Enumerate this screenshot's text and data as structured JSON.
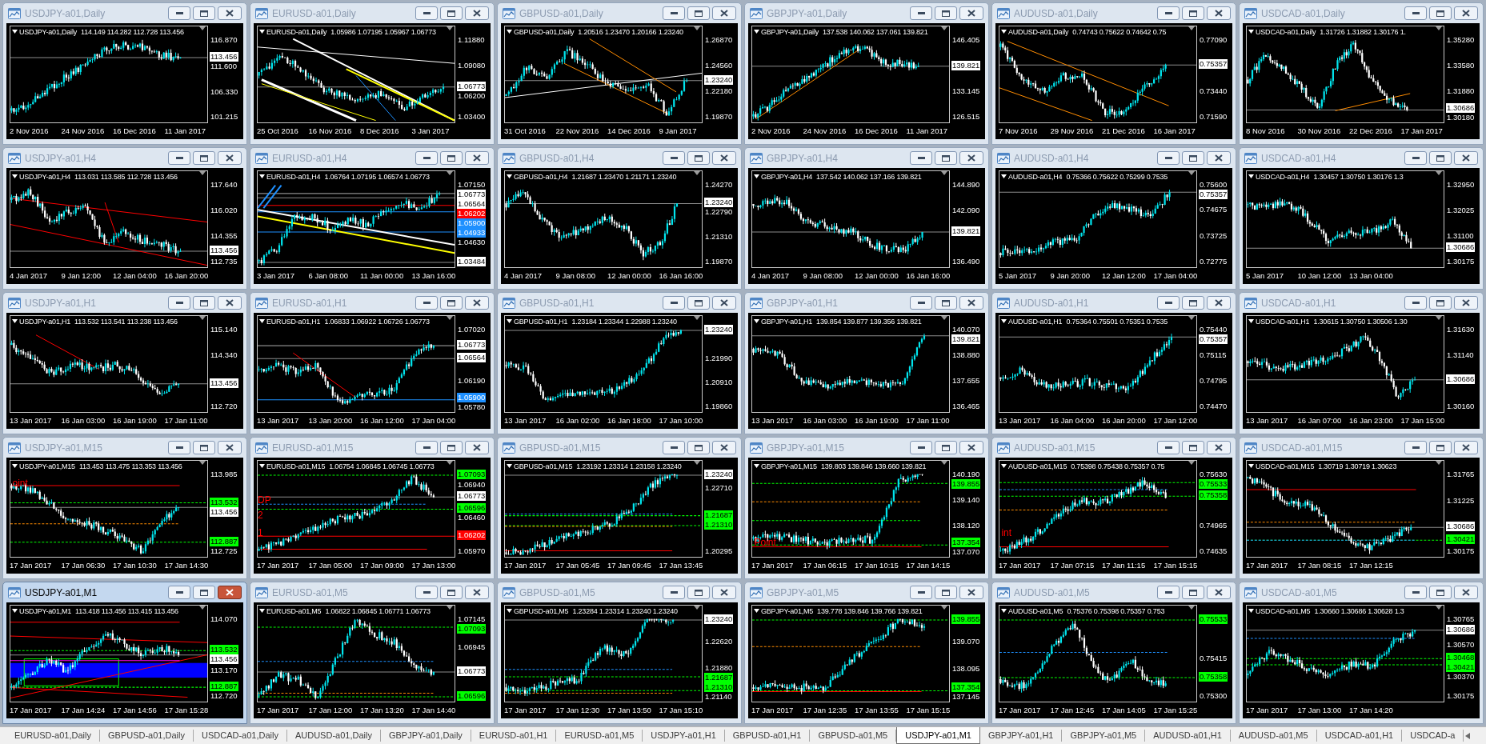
{
  "windows": [
    {
      "title": "USDJPY-a01,Daily",
      "active": false,
      "chart": {
        "symbol": "USDJPY-a01,Daily",
        "ohlc": "114.149 114.282 112.728 113.456",
        "price_labels": [
          {
            "text": "116.870",
            "kind": "tick"
          },
          {
            "text": "113.456",
            "kind": "marker",
            "color": "#ffffff"
          },
          {
            "text": "111.600",
            "kind": "tick"
          },
          {
            "text": "106.330",
            "kind": "tick"
          },
          {
            "text": "101.215",
            "kind": "tick"
          }
        ],
        "time_labels": [
          "2 Nov 2016",
          "24 Nov 2016",
          "16 Dec 2016",
          "11 Jan 2017"
        ]
      }
    },
    {
      "title": "EURUSD-a01,Daily",
      "active": false,
      "chart": {
        "symbol": "EURUSD-a01,Daily",
        "ohlc": "1.05986 1.07195 1.05967 1.06773",
        "price_labels": [
          {
            "text": "1.11880",
            "kind": "tick"
          },
          {
            "text": "1.09080",
            "kind": "tick"
          },
          {
            "text": "1.06773",
            "kind": "marker",
            "color": "#ffffff"
          },
          {
            "text": "1.06200",
            "kind": "tick"
          },
          {
            "text": "1.03400",
            "kind": "tick"
          }
        ],
        "time_labels": [
          "25 Oct 2016",
          "16 Nov 2016",
          "8 Dec 2016",
          "3 Jan 2017"
        ]
      }
    },
    {
      "title": "GBPUSD-a01,Daily",
      "active": false,
      "chart": {
        "symbol": "GBPUSD-a01,Daily",
        "ohlc": "1.20516 1.23470 1.20166 1.23240",
        "price_labels": [
          {
            "text": "1.26870",
            "kind": "tick"
          },
          {
            "text": "1.24560",
            "kind": "tick"
          },
          {
            "text": "1.23240",
            "kind": "marker",
            "color": "#ffffff"
          },
          {
            "text": "1.22180",
            "kind": "tick"
          },
          {
            "text": "1.19870",
            "kind": "tick"
          }
        ],
        "time_labels": [
          "31 Oct 2016",
          "22 Nov 2016",
          "14 Dec 2016",
          "9 Jan 2017"
        ]
      }
    },
    {
      "title": "GBPJPY-a01,Daily",
      "active": false,
      "chart": {
        "symbol": "GBPJPY-a01,Daily",
        "ohlc": "137.538 140.062 137.061 139.821",
        "price_labels": [
          {
            "text": "146.405",
            "kind": "tick"
          },
          {
            "text": "139.821",
            "kind": "marker",
            "color": "#ffffff"
          },
          {
            "text": "133.145",
            "kind": "tick"
          },
          {
            "text": "126.515",
            "kind": "tick"
          }
        ],
        "time_labels": [
          "2 Nov 2016",
          "24 Nov 2016",
          "16 Dec 2016",
          "11 Jan 2017"
        ]
      }
    },
    {
      "title": "AUDUSD-a01,Daily",
      "active": false,
      "chart": {
        "symbol": "AUDUSD-a01,Daily",
        "ohlc": "0.74743 0.75622 0.74642 0.75",
        "price_labels": [
          {
            "text": "0.77090",
            "kind": "tick"
          },
          {
            "text": "0.75357",
            "kind": "marker",
            "color": "#ffffff"
          },
          {
            "text": "0.73440",
            "kind": "tick"
          },
          {
            "text": "0.71590",
            "kind": "tick"
          }
        ],
        "time_labels": [
          "7 Nov 2016",
          "29 Nov 2016",
          "21 Dec 2016",
          "16 Jan 2017"
        ]
      }
    },
    {
      "title": "USDCAD-a01,Daily",
      "active": false,
      "chart": {
        "symbol": "USDCAD-a01,Daily",
        "ohlc": "1.31726 1.31882 1.30176 1.",
        "price_labels": [
          {
            "text": "1.35280",
            "kind": "tick"
          },
          {
            "text": "1.33580",
            "kind": "tick"
          },
          {
            "text": "1.31880",
            "kind": "tick"
          },
          {
            "text": "1.30686",
            "kind": "marker",
            "color": "#ffffff"
          },
          {
            "text": "1.30180",
            "kind": "tick"
          }
        ],
        "time_labels": [
          "8 Nov 2016",
          "30 Nov 2016",
          "22 Dec 2016",
          "17 Jan 2017"
        ]
      }
    },
    {
      "title": "USDJPY-a01,H4",
      "active": false,
      "chart": {
        "symbol": "USDJPY-a01,H4",
        "ohlc": "113.031 113.585 112.728 113.456",
        "price_labels": [
          {
            "text": "117.640",
            "kind": "tick"
          },
          {
            "text": "116.020",
            "kind": "tick"
          },
          {
            "text": "114.355",
            "kind": "tick"
          },
          {
            "text": "113.456",
            "kind": "marker",
            "color": "#ffffff"
          },
          {
            "text": "112.735",
            "kind": "tick"
          }
        ],
        "time_labels": [
          "4 Jan 2017",
          "9 Jan 12:00",
          "12 Jan 04:00",
          "16 Jan 20:00"
        ]
      }
    },
    {
      "title": "EURUSD-a01,H4",
      "active": false,
      "chart": {
        "symbol": "EURUSD-a01,H4",
        "ohlc": "1.06764 1.07195 1.06574 1.06773",
        "price_labels": [
          {
            "text": "1.07150",
            "kind": "tick"
          },
          {
            "text": "1.06773",
            "kind": "marker",
            "color": "#ffffff"
          },
          {
            "text": "1.06564",
            "kind": "marker",
            "color": "#ffffff"
          },
          {
            "text": "1.06202",
            "kind": "marker",
            "color": "#ff0000"
          },
          {
            "text": "1.05900",
            "kind": "marker",
            "color": "#1e90ff"
          },
          {
            "text": "1.04933",
            "kind": "marker",
            "color": "#1e90ff"
          },
          {
            "text": "1.04630",
            "kind": "tick"
          },
          {
            "text": "1.03484",
            "kind": "marker",
            "color": "#ffffff"
          }
        ],
        "time_labels": [
          "3 Jan 2017",
          "6 Jan 08:00",
          "11 Jan 00:00",
          "13 Jan 16:00"
        ]
      }
    },
    {
      "title": "GBPUSD-a01,H4",
      "active": false,
      "chart": {
        "symbol": "GBPUSD-a01,H4",
        "ohlc": "1.21687 1.23470 1.21171 1.23240",
        "price_labels": [
          {
            "text": "1.24270",
            "kind": "tick"
          },
          {
            "text": "1.23240",
            "kind": "marker",
            "color": "#ffffff"
          },
          {
            "text": "1.22790",
            "kind": "tick"
          },
          {
            "text": "1.21310",
            "kind": "tick"
          },
          {
            "text": "1.19870",
            "kind": "tick"
          }
        ],
        "time_labels": [
          "4 Jan 2017",
          "9 Jan 08:00",
          "12 Jan 00:00",
          "16 Jan 16:00"
        ]
      }
    },
    {
      "title": "GBPJPY-a01,H4",
      "active": false,
      "chart": {
        "symbol": "GBPJPY-a01,H4",
        "ohlc": "137.542 140.062 137.166 139.821",
        "price_labels": [
          {
            "text": "144.890",
            "kind": "tick"
          },
          {
            "text": "142.090",
            "kind": "tick"
          },
          {
            "text": "139.821",
            "kind": "marker",
            "color": "#ffffff"
          },
          {
            "text": "136.490",
            "kind": "tick"
          }
        ],
        "time_labels": [
          "4 Jan 2017",
          "9 Jan 08:00",
          "12 Jan 00:00",
          "16 Jan 16:00"
        ]
      }
    },
    {
      "title": "AUDUSD-a01,H4",
      "active": false,
      "chart": {
        "symbol": "AUDUSD-a01,H4",
        "ohlc": "0.75366 0.75622 0.75299 0.7535",
        "price_labels": [
          {
            "text": "0.75600",
            "kind": "tick"
          },
          {
            "text": "0.75357",
            "kind": "marker",
            "color": "#ffffff"
          },
          {
            "text": "0.74675",
            "kind": "tick"
          },
          {
            "text": "0.73725",
            "kind": "tick"
          },
          {
            "text": "0.72775",
            "kind": "tick"
          }
        ],
        "time_labels": [
          "5 Jan 2017",
          "9 Jan 20:00",
          "12 Jan 12:00",
          "17 Jan 04:00"
        ]
      }
    },
    {
      "title": "USDCAD-a01,H4",
      "active": false,
      "chart": {
        "symbol": "USDCAD-a01,H4",
        "ohlc": "1.30457 1.30750 1.30176 1.3",
        "price_labels": [
          {
            "text": "1.32950",
            "kind": "tick"
          },
          {
            "text": "1.32025",
            "kind": "tick"
          },
          {
            "text": "1.31100",
            "kind": "tick"
          },
          {
            "text": "1.30686",
            "kind": "marker",
            "color": "#ffffff"
          },
          {
            "text": "1.30175",
            "kind": "tick"
          }
        ],
        "time_labels": [
          "5 Jan 2017",
          "10 Jan 12:00",
          "13 Jan 04:00"
        ]
      }
    },
    {
      "title": "USDJPY-a01,H1",
      "active": false,
      "chart": {
        "symbol": "USDJPY-a01,H1",
        "ohlc": "113.532 113.541 113.238 113.456",
        "price_labels": [
          {
            "text": "115.140",
            "kind": "tick"
          },
          {
            "text": "114.340",
            "kind": "tick"
          },
          {
            "text": "113.456",
            "kind": "marker",
            "color": "#ffffff"
          },
          {
            "text": "112.720",
            "kind": "tick"
          }
        ],
        "time_labels": [
          "13 Jan 2017",
          "16 Jan 03:00",
          "16 Jan 19:00",
          "17 Jan 11:00"
        ]
      }
    },
    {
      "title": "EURUSD-a01,H1",
      "active": false,
      "chart": {
        "symbol": "EURUSD-a01,H1",
        "ohlc": "1.06833 1.06922 1.06726 1.06773",
        "price_labels": [
          {
            "text": "1.07020",
            "kind": "tick"
          },
          {
            "text": "1.06773",
            "kind": "marker",
            "color": "#ffffff"
          },
          {
            "text": "1.06564",
            "kind": "marker",
            "color": "#ffffff"
          },
          {
            "text": "1.06190",
            "kind": "tick"
          },
          {
            "text": "1.05900",
            "kind": "marker",
            "color": "#1e90ff"
          },
          {
            "text": "1.05780",
            "kind": "tick"
          }
        ],
        "time_labels": [
          "13 Jan 2017",
          "13 Jan 20:00",
          "16 Jan 12:00",
          "17 Jan 04:00"
        ]
      }
    },
    {
      "title": "GBPUSD-a01,H1",
      "active": false,
      "chart": {
        "symbol": "GBPUSD-a01,H1",
        "ohlc": "1.23184 1.23344 1.22988 1.23240",
        "price_labels": [
          {
            "text": "1.23240",
            "kind": "marker",
            "color": "#ffffff"
          },
          {
            "text": "1.21990",
            "kind": "tick"
          },
          {
            "text": "1.20910",
            "kind": "tick"
          },
          {
            "text": "1.19860",
            "kind": "tick"
          }
        ],
        "time_labels": [
          "13 Jan 2017",
          "16 Jan 02:00",
          "16 Jan 18:00",
          "17 Jan 10:00"
        ]
      }
    },
    {
      "title": "GBPJPY-a01,H1",
      "active": false,
      "chart": {
        "symbol": "GBPJPY-a01,H1",
        "ohlc": "139.854 139.877 139.356 139.821",
        "price_labels": [
          {
            "text": "140.070",
            "kind": "tick"
          },
          {
            "text": "139.821",
            "kind": "marker",
            "color": "#ffffff"
          },
          {
            "text": "138.880",
            "kind": "tick"
          },
          {
            "text": "137.655",
            "kind": "tick"
          },
          {
            "text": "136.465",
            "kind": "tick"
          }
        ],
        "time_labels": [
          "13 Jan 2017",
          "16 Jan 03:00",
          "16 Jan 19:00",
          "17 Jan 11:00"
        ]
      }
    },
    {
      "title": "AUDUSD-a01,H1",
      "active": false,
      "chart": {
        "symbol": "AUDUSD-a01,H1",
        "ohlc": "0.75364 0.75501 0.75351 0.7535",
        "price_labels": [
          {
            "text": "0.75440",
            "kind": "tick"
          },
          {
            "text": "0.75357",
            "kind": "marker",
            "color": "#ffffff"
          },
          {
            "text": "0.75115",
            "kind": "tick"
          },
          {
            "text": "0.74795",
            "kind": "tick"
          },
          {
            "text": "0.74470",
            "kind": "tick"
          }
        ],
        "time_labels": [
          "13 Jan 2017",
          "16 Jan 04:00",
          "16 Jan 20:00",
          "17 Jan 12:00"
        ]
      }
    },
    {
      "title": "USDCAD-a01,H1",
      "active": false,
      "chart": {
        "symbol": "USDCAD-a01,H1",
        "ohlc": "1.30615 1.30750 1.30506 1.30",
        "price_labels": [
          {
            "text": "1.31630",
            "kind": "tick"
          },
          {
            "text": "1.31140",
            "kind": "tick"
          },
          {
            "text": "1.30686",
            "kind": "marker",
            "color": "#ffffff"
          },
          {
            "text": "1.30160",
            "kind": "tick"
          }
        ],
        "time_labels": [
          "13 Jan 2017",
          "16 Jan 07:00",
          "16 Jan 23:00",
          "17 Jan 15:00"
        ]
      }
    },
    {
      "title": "USDJPY-a01,M15",
      "active": false,
      "chart": {
        "symbol": "USDJPY-a01,M15",
        "ohlc": "113.453 113.475 113.353 113.456",
        "price_labels": [
          {
            "text": "113.985",
            "kind": "tick"
          },
          {
            "text": "113.532",
            "kind": "marker",
            "color": "#00ff00"
          },
          {
            "text": "113.456",
            "kind": "marker",
            "color": "#ffffff"
          },
          {
            "text": "112.887",
            "kind": "marker",
            "color": "#00ff00"
          },
          {
            "text": "112.725",
            "kind": "tick"
          }
        ],
        "time_labels": [
          "17 Jan 2017",
          "17 Jan 06:30",
          "17 Jan 10:30",
          "17 Jan 14:30"
        ],
        "annotations": [
          "oint"
        ]
      }
    },
    {
      "title": "EURUSD-a01,M15",
      "active": false,
      "chart": {
        "symbol": "EURUSD-a01,M15",
        "ohlc": "1.06754 1.06845 1.06745 1.06773",
        "price_labels": [
          {
            "text": "1.07093",
            "kind": "marker",
            "color": "#00ff00"
          },
          {
            "text": "1.06940",
            "kind": "tick"
          },
          {
            "text": "1.06773",
            "kind": "marker",
            "color": "#ffffff"
          },
          {
            "text": "1.06596",
            "kind": "marker",
            "color": "#00ff00"
          },
          {
            "text": "1.06460",
            "kind": "tick"
          },
          {
            "text": "1.06202",
            "kind": "marker",
            "color": "#ff0000"
          },
          {
            "text": "1.05970",
            "kind": "tick"
          }
        ],
        "time_labels": [
          "17 Jan 2017",
          "17 Jan 05:00",
          "17 Jan 09:00",
          "17 Jan 13:00"
        ],
        "annotations": [
          "DP",
          "2",
          "1"
        ]
      }
    },
    {
      "title": "GBPUSD-a01,M15",
      "active": false,
      "chart": {
        "symbol": "GBPUSD-a01,M15",
        "ohlc": "1.23192 1.23314 1.23158 1.23240",
        "price_labels": [
          {
            "text": "1.23240",
            "kind": "marker",
            "color": "#ffffff"
          },
          {
            "text": "1.22710",
            "kind": "tick"
          },
          {
            "text": "1.21687",
            "kind": "marker",
            "color": "#00ff00"
          },
          {
            "text": "1.21310",
            "kind": "marker",
            "color": "#00ff00"
          },
          {
            "text": "1.20295",
            "kind": "tick"
          }
        ],
        "time_labels": [
          "17 Jan 2017",
          "17 Jan 05:45",
          "17 Jan 09:45",
          "17 Jan 13:45"
        ]
      }
    },
    {
      "title": "GBPJPY-a01,M15",
      "active": false,
      "chart": {
        "symbol": "GBPJPY-a01,M15",
        "ohlc": "139.803 139.846 139.660 139.821",
        "price_labels": [
          {
            "text": "140.190",
            "kind": "tick"
          },
          {
            "text": "139.855",
            "kind": "marker",
            "color": "#00ff00"
          },
          {
            "text": "139.140",
            "kind": "tick"
          },
          {
            "text": "138.120",
            "kind": "tick"
          },
          {
            "text": "137.354",
            "kind": "marker",
            "color": "#00ff00"
          },
          {
            "text": "137.070",
            "kind": "tick"
          }
        ],
        "time_labels": [
          "17 Jan 2017",
          "17 Jan 06:15",
          "17 Jan 10:15",
          "17 Jan 14:15"
        ],
        "annotations": [
          "Point"
        ]
      }
    },
    {
      "title": "AUDUSD-a01,M15",
      "active": false,
      "chart": {
        "symbol": "AUDUSD-a01,M15",
        "ohlc": "0.75398 0.75438 0.75357 0.75",
        "price_labels": [
          {
            "text": "0.75630",
            "kind": "tick"
          },
          {
            "text": "0.75533",
            "kind": "marker",
            "color": "#00ff00"
          },
          {
            "text": "0.75358",
            "kind": "marker",
            "color": "#00ff00"
          },
          {
            "text": "0.74965",
            "kind": "tick"
          },
          {
            "text": "0.74635",
            "kind": "tick"
          }
        ],
        "time_labels": [
          "17 Jan 2017",
          "17 Jan 07:15",
          "17 Jan 11:15",
          "17 Jan 15:15"
        ],
        "annotations": [
          "int"
        ]
      }
    },
    {
      "title": "USDCAD-a01,M15",
      "active": false,
      "chart": {
        "symbol": "USDCAD-a01,M15",
        "ohlc": "1.30719 1.30719 1.30623",
        "price_labels": [
          {
            "text": "1.31765",
            "kind": "tick"
          },
          {
            "text": "1.31225",
            "kind": "tick"
          },
          {
            "text": "1.30686",
            "kind": "marker",
            "color": "#ffffff"
          },
          {
            "text": "1.30421",
            "kind": "marker",
            "color": "#00ff00"
          },
          {
            "text": "1.30175",
            "kind": "tick"
          }
        ],
        "time_labels": [
          "17 Jan 2017",
          "17 Jan 08:15",
          "17 Jan 12:15"
        ]
      }
    },
    {
      "title": "USDJPY-a01,M1",
      "active": true,
      "chart": {
        "symbol": "USDJPY-a01,M1",
        "ohlc": "113.418 113.456 113.415 113.456",
        "price_labels": [
          {
            "text": "114.070",
            "kind": "tick"
          },
          {
            "text": "113.532",
            "kind": "marker",
            "color": "#00ff00"
          },
          {
            "text": "113.456",
            "kind": "marker",
            "color": "#ffffff"
          },
          {
            "text": "113.170",
            "kind": "tick"
          },
          {
            "text": "112.887",
            "kind": "marker",
            "color": "#00ff00"
          },
          {
            "text": "112.720",
            "kind": "tick"
          }
        ],
        "time_labels": [
          "17 Jan 2017",
          "17 Jan 14:24",
          "17 Jan 14:56",
          "17 Jan 15:28"
        ]
      }
    },
    {
      "title": "EURUSD-a01,M5",
      "active": false,
      "chart": {
        "symbol": "EURUSD-a01,M5",
        "ohlc": "1.06822 1.06845 1.06771 1.06773",
        "price_labels": [
          {
            "text": "1.07145",
            "kind": "tick"
          },
          {
            "text": "1.07093",
            "kind": "marker",
            "color": "#00ff00"
          },
          {
            "text": "1.06945",
            "kind": "tick"
          },
          {
            "text": "1.06773",
            "kind": "marker",
            "color": "#ffffff"
          },
          {
            "text": "1.06596",
            "kind": "marker",
            "color": "#00ff00"
          }
        ],
        "time_labels": [
          "17 Jan 2017",
          "17 Jan 12:00",
          "17 Jan 13:20",
          "17 Jan 14:40"
        ]
      }
    },
    {
      "title": "GBPUSD-a01,M5",
      "active": false,
      "chart": {
        "symbol": "GBPUSD-a01,M5",
        "ohlc": "1.23284 1.23314 1.23240 1.23240",
        "price_labels": [
          {
            "text": "1.23240",
            "kind": "marker",
            "color": "#ffffff"
          },
          {
            "text": "1.22620",
            "kind": "tick"
          },
          {
            "text": "1.21880",
            "kind": "tick"
          },
          {
            "text": "1.21687",
            "kind": "marker",
            "color": "#00ff00"
          },
          {
            "text": "1.21310",
            "kind": "marker",
            "color": "#00ff00"
          },
          {
            "text": "1.21140",
            "kind": "tick"
          }
        ],
        "time_labels": [
          "17 Jan 2017",
          "17 Jan 12:30",
          "17 Jan 13:50",
          "17 Jan 15:10"
        ]
      }
    },
    {
      "title": "GBPJPY-a01,M5",
      "active": false,
      "chart": {
        "symbol": "GBPJPY-a01,M5",
        "ohlc": "139.778 139.846 139.766 139.821",
        "price_labels": [
          {
            "text": "139.855",
            "kind": "marker",
            "color": "#00ff00"
          },
          {
            "text": "139.070",
            "kind": "tick"
          },
          {
            "text": "138.095",
            "kind": "tick"
          },
          {
            "text": "137.354",
            "kind": "marker",
            "color": "#00ff00"
          },
          {
            "text": "137.145",
            "kind": "tick"
          }
        ],
        "time_labels": [
          "17 Jan 2017",
          "17 Jan 12:35",
          "17 Jan 13:55",
          "17 Jan 15:15"
        ]
      }
    },
    {
      "title": "AUDUSD-a01,M5",
      "active": false,
      "chart": {
        "symbol": "AUDUSD-a01,M5",
        "ohlc": "0.75376 0.75398 0.75357 0.753",
        "price_labels": [
          {
            "text": "0.75533",
            "kind": "marker",
            "color": "#00ff00"
          },
          {
            "text": "0.75415",
            "kind": "tick"
          },
          {
            "text": "0.75358",
            "kind": "marker",
            "color": "#00ff00"
          },
          {
            "text": "0.75300",
            "kind": "tick"
          }
        ],
        "time_labels": [
          "17 Jan 2017",
          "17 Jan 12:45",
          "17 Jan 14:05",
          "17 Jan 15:25"
        ]
      }
    },
    {
      "title": "USDCAD-a01,M5",
      "active": false,
      "chart": {
        "symbol": "USDCAD-a01,M5",
        "ohlc": "1.30660 1.30686 1.30628 1.3",
        "price_labels": [
          {
            "text": "1.30765",
            "kind": "tick"
          },
          {
            "text": "1.30686",
            "kind": "marker",
            "color": "#ffffff"
          },
          {
            "text": "1.30570",
            "kind": "tick"
          },
          {
            "text": "1.30468",
            "kind": "marker",
            "color": "#00ff00"
          },
          {
            "text": "1.30421",
            "kind": "marker",
            "color": "#00ff00"
          },
          {
            "text": "1.30370",
            "kind": "tick"
          },
          {
            "text": "1.30175",
            "kind": "tick"
          }
        ],
        "time_labels": [
          "17 Jan 2017",
          "17 Jan 13:00",
          "17 Jan 14:20"
        ]
      }
    }
  ],
  "tabs": [
    {
      "label": "EURUSD-a01,Daily",
      "selected": false
    },
    {
      "label": "GBPUSD-a01,Daily",
      "selected": false
    },
    {
      "label": "USDCAD-a01,Daily",
      "selected": false
    },
    {
      "label": "AUDUSD-a01,Daily",
      "selected": false
    },
    {
      "label": "GBPJPY-a01,Daily",
      "selected": false
    },
    {
      "label": "EURUSD-a01,H1",
      "selected": false
    },
    {
      "label": "EURUSD-a01,M5",
      "selected": false
    },
    {
      "label": "USDJPY-a01,H1",
      "selected": false
    },
    {
      "label": "GBPUSD-a01,H1",
      "selected": false
    },
    {
      "label": "GBPUSD-a01,M5",
      "selected": false
    },
    {
      "label": "USDJPY-a01,M1",
      "selected": true
    },
    {
      "label": "GBPJPY-a01,H1",
      "selected": false
    },
    {
      "label": "GBPJPY-a01,M5",
      "selected": false
    },
    {
      "label": "AUDUSD-a01,H1",
      "selected": false
    },
    {
      "label": "AUDUSD-a01,M5",
      "selected": false
    },
    {
      "label": "USDCAD-a01,H1",
      "selected": false
    },
    {
      "label": "USDCAD-a",
      "selected": false
    }
  ]
}
